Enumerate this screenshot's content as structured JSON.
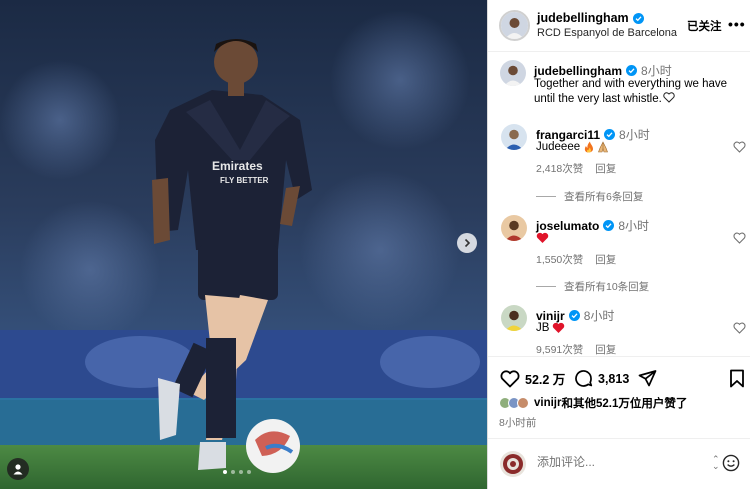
{
  "post": {
    "username": "judebellingham",
    "location": "RCD Espanyol de Barcelona",
    "follow_label": "已关注",
    "more_label": "•••"
  },
  "caption": {
    "username": "judebellingham",
    "time": "8小时",
    "text": "Together and with everything we have until the very last whistle."
  },
  "comments": [
    {
      "username": "frangarci11",
      "time": "8小时",
      "text": "Judeeee",
      "emojis": [
        "fire-emoji",
        "folded-hands-emoji"
      ],
      "likes": "2,418次赞",
      "reply": "回复",
      "view_replies": "查看所有6条回复"
    },
    {
      "username": "joselumato",
      "time": "8小时",
      "text": "",
      "emojis": [
        "red-heart-emoji"
      ],
      "likes": "1,550次赞",
      "reply": "回复",
      "view_replies": "查看所有10条回复"
    },
    {
      "username": "vinijr",
      "time": "8小时",
      "text": "JB",
      "emojis": [
        "red-heart-emoji"
      ],
      "likes": "9,591次赞",
      "reply": "回复",
      "view_replies": ""
    }
  ],
  "actions": {
    "likes_count": "52.2 万",
    "comments_count": "3,813",
    "liked_by_user": "vinijr",
    "liked_by_rest": "和其他52.1万位用户赞了",
    "post_time": "8小时前"
  },
  "add_comment": {
    "placeholder": "添加评论..."
  },
  "carousel": {
    "dot_count": 4,
    "active_index": 0
  },
  "colors": {
    "verified_blue": "#0095f6",
    "heart_red": "#e0142a",
    "secondary_text": "#737373",
    "jersey_navy": "#1c2236",
    "pitch_green": "#3f7a3a",
    "ad_board_blue": "#2d4a8f"
  },
  "icons": {
    "like": "heart-outline-icon",
    "comment": "speech-bubble-icon",
    "share": "paper-plane-icon",
    "save": "bookmark-icon",
    "next": "chevron-right-icon",
    "tag": "person-tag-icon",
    "emoji": "smiley-icon",
    "sort": "up-down-arrows-icon"
  }
}
